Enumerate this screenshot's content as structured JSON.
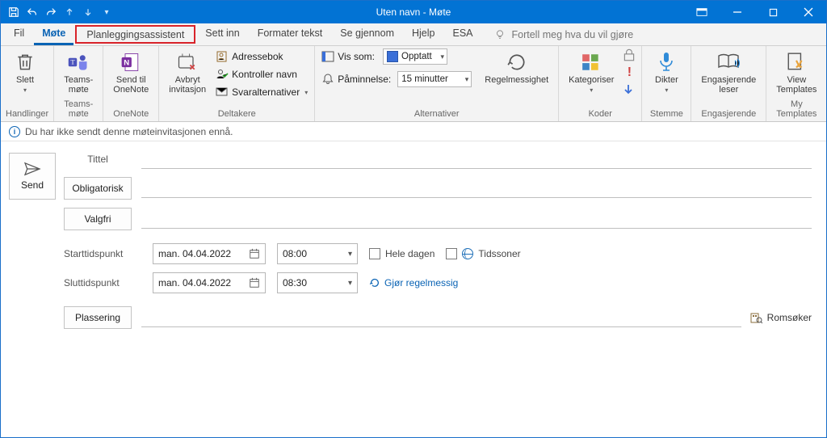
{
  "titlebar": {
    "title": "Uten navn  -  Møte",
    "qat_icons": [
      "save-icon",
      "undo-icon",
      "redo-icon",
      "arrow-up-icon",
      "arrow-down-icon",
      "customize-icon"
    ]
  },
  "tabs": {
    "items": [
      {
        "label": "Fil"
      },
      {
        "label": "Møte"
      },
      {
        "label": "Planleggingsassistent"
      },
      {
        "label": "Sett inn"
      },
      {
        "label": "Formater tekst"
      },
      {
        "label": "Se gjennom"
      },
      {
        "label": "Hjelp"
      },
      {
        "label": "ESA"
      }
    ],
    "active_index": 1,
    "highlighted_index": 2,
    "tell_me_placeholder": "Fortell meg hva du vil gjøre"
  },
  "ribbon": {
    "groups": {
      "handlinger": {
        "label": "Handlinger",
        "delete": "Slett"
      },
      "teams": {
        "label": "Teams-møte",
        "button": "Teams-\nmøte"
      },
      "onenote": {
        "label": "OneNote",
        "button": "Send til\nOneNote"
      },
      "deltakere": {
        "label": "Deltakere",
        "cancel": "Avbryt\ninvitasjon",
        "addressbook": "Adressebok",
        "check_names": "Kontroller navn",
        "response_opts": "Svaralternativer"
      },
      "alternativer": {
        "label": "Alternativer",
        "show_as_label": "Vis som:",
        "show_as_value": "Opptatt",
        "reminder_label": "Påminnelse:",
        "reminder_value": "15 minutter",
        "recurrence": "Regelmessighet"
      },
      "koder": {
        "label": "Koder",
        "categorize": "Kategoriser"
      },
      "stemme": {
        "label": "Stemme",
        "dictate": "Dikter"
      },
      "engasjerende": {
        "label": "Engasjerende",
        "reader": "Engasjerende\nleser"
      },
      "templates": {
        "label": "My Templates",
        "view": "View\nTemplates"
      }
    }
  },
  "infobar": {
    "text": "Du har ikke sendt denne møteinvitasjonen ennå."
  },
  "form": {
    "send": "Send",
    "title_label": "Tittel",
    "title_value": "",
    "required_label": "Obligatorisk",
    "required_value": "",
    "optional_label": "Valgfri",
    "optional_value": "",
    "start_label": "Starttidspunkt",
    "start_date": "man. 04.04.2022",
    "start_time": "08:00",
    "end_label": "Sluttidspunkt",
    "end_date": "man. 04.04.2022",
    "end_time": "08:30",
    "all_day": "Hele dagen",
    "timezones": "Tidssoner",
    "make_recurring": "Gjør regelmessig",
    "location_label": "Plassering",
    "location_value": "",
    "room_finder": "Romsøker"
  }
}
